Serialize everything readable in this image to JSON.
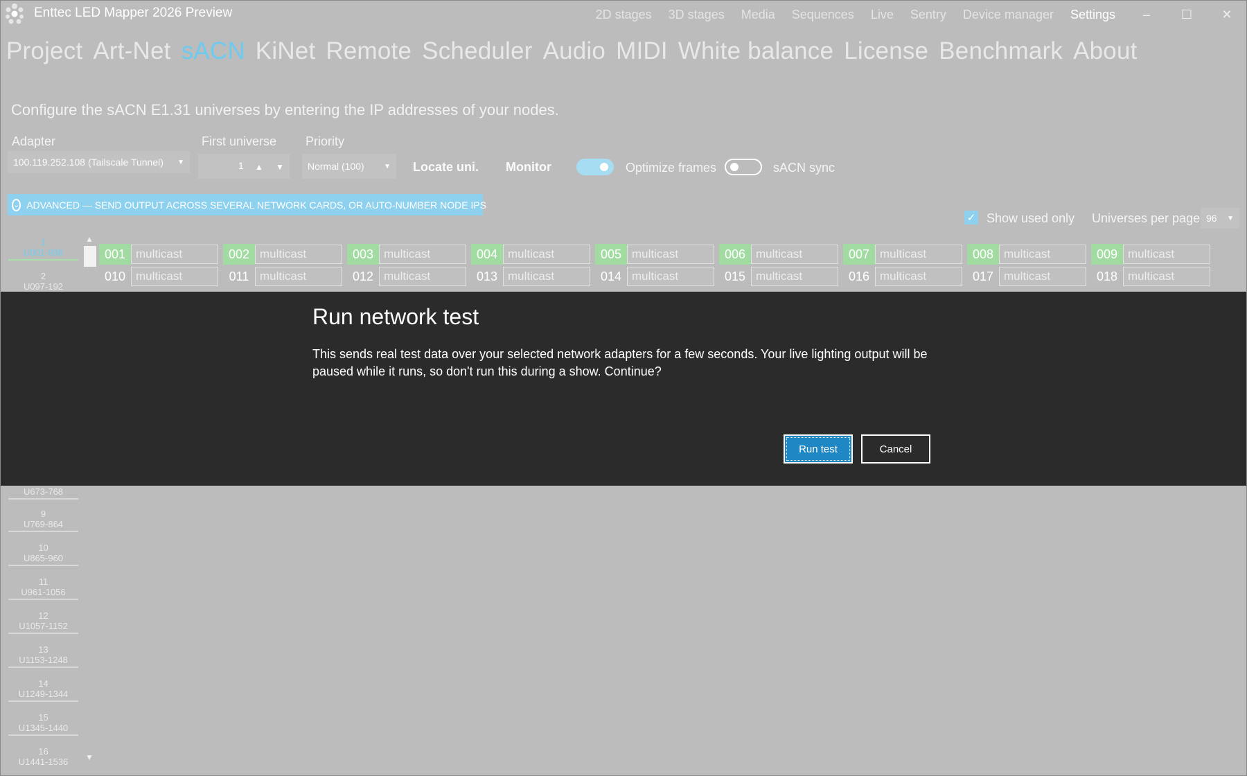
{
  "app": {
    "title": "Enttec LED Mapper 2026 Preview"
  },
  "topnav": [
    {
      "label": "2D stages"
    },
    {
      "label": "3D stages"
    },
    {
      "label": "Media"
    },
    {
      "label": "Sequences"
    },
    {
      "label": "Live"
    },
    {
      "label": "Sentry"
    },
    {
      "label": "Device manager"
    },
    {
      "label": "Settings"
    }
  ],
  "window_controls": {
    "minimize": "–",
    "maximize": "☐",
    "close": "✕"
  },
  "tabs": [
    {
      "label": "Project"
    },
    {
      "label": "Art-Net"
    },
    {
      "label": "sACN"
    },
    {
      "label": "KiNet"
    },
    {
      "label": "Remote"
    },
    {
      "label": "Scheduler"
    },
    {
      "label": "Audio"
    },
    {
      "label": "MIDI"
    },
    {
      "label": "White balance"
    },
    {
      "label": "License"
    },
    {
      "label": "Benchmark"
    },
    {
      "label": "About"
    }
  ],
  "active_tab": "sACN",
  "description": "Configure the sACN E1.31 universes by entering the IP addresses of your nodes.",
  "adapter": {
    "label": "Adapter",
    "value": "100.119.252.108 (Tailscale Tunnel)"
  },
  "first_universe": {
    "label": "First universe",
    "value": "1"
  },
  "priority": {
    "label": "Priority",
    "value": "Normal (100)"
  },
  "locate_label": "Locate uni.",
  "monitor_label": "Monitor",
  "optimize_frames": {
    "label": "Optimize frames",
    "on": true
  },
  "sacn_sync": {
    "label": "sACN sync",
    "on": false
  },
  "advanced_label": "ADVANCED — SEND OUTPUT ACROSS SEVERAL NETWORK CARDS, OR AUTO-NUMBER NODE IPS",
  "show_used_only": {
    "label": "Show used only",
    "checked": true
  },
  "universes_per_page": {
    "label": "Universes per page",
    "value": "96"
  },
  "pages": [
    {
      "num": "1",
      "range": "U001-096"
    },
    {
      "num": "2",
      "range": "U097-192"
    },
    {
      "num": "",
      "range": "U673-768"
    },
    {
      "num": "9",
      "range": "U769-864"
    },
    {
      "num": "10",
      "range": "U865-960"
    },
    {
      "num": "11",
      "range": "U961-1056"
    },
    {
      "num": "12",
      "range": "U1057-1152"
    },
    {
      "num": "13",
      "range": "U1153-1248"
    },
    {
      "num": "14",
      "range": "U1249-1344"
    },
    {
      "num": "15",
      "range": "U1345-1440"
    },
    {
      "num": "16",
      "range": "U1441-1536"
    }
  ],
  "universe_rows": [
    [
      {
        "num": "001",
        "value": "multicast"
      },
      {
        "num": "002",
        "value": "multicast"
      },
      {
        "num": "003",
        "value": "multicast"
      },
      {
        "num": "004",
        "value": "multicast"
      },
      {
        "num": "005",
        "value": "multicast"
      },
      {
        "num": "006",
        "value": "multicast"
      },
      {
        "num": "007",
        "value": "multicast"
      },
      {
        "num": "008",
        "value": "multicast"
      },
      {
        "num": "009",
        "value": "multicast"
      }
    ],
    [
      {
        "num": "010",
        "value": "multicast"
      },
      {
        "num": "011",
        "value": "multicast"
      },
      {
        "num": "012",
        "value": "multicast"
      },
      {
        "num": "013",
        "value": "multicast"
      },
      {
        "num": "014",
        "value": "multicast"
      },
      {
        "num": "015",
        "value": "multicast"
      },
      {
        "num": "016",
        "value": "multicast"
      },
      {
        "num": "017",
        "value": "multicast"
      },
      {
        "num": "018",
        "value": "multicast"
      }
    ]
  ],
  "dialog": {
    "title": "Run network test",
    "body": "This sends real test data over your selected network adapters for a few seconds. Your live lighting output will be paused while it runs, so don't run this during a show. Continue?",
    "confirm": "Run test",
    "cancel": "Cancel"
  },
  "colors": {
    "accent": "#6ecbef",
    "toggle_on": "#a6ddf3",
    "used_universe": "#a2dba2",
    "dialog_bg": "#2b2b2b",
    "primary_button": "#1f88c4"
  }
}
